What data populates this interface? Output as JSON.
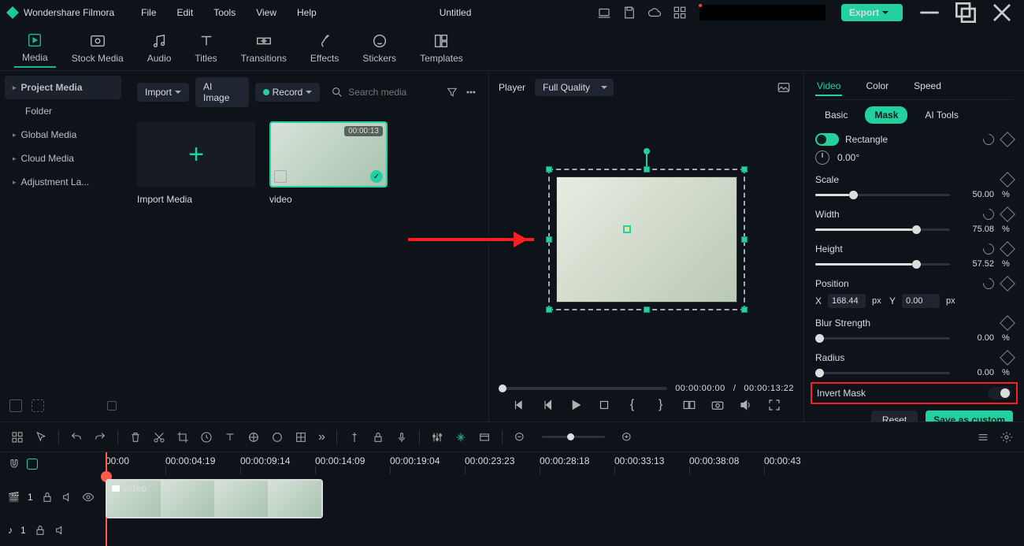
{
  "app_title": "Wondershare Filmora",
  "menus": [
    "File",
    "Edit",
    "Tools",
    "View",
    "Help"
  ],
  "doc_title": "Untitled",
  "export_label": "Export",
  "main_tabs": [
    {
      "label": "Media",
      "active": true
    },
    {
      "label": "Stock Media"
    },
    {
      "label": "Audio"
    },
    {
      "label": "Titles"
    },
    {
      "label": "Transitions"
    },
    {
      "label": "Effects"
    },
    {
      "label": "Stickers"
    },
    {
      "label": "Templates"
    }
  ],
  "sidebar": [
    {
      "label": "Project Media",
      "active": true
    },
    {
      "label": "Folder",
      "indent": true
    },
    {
      "label": "Global Media",
      "expand": true
    },
    {
      "label": "Cloud Media",
      "expand": true
    },
    {
      "label": "Adjustment La...",
      "expand": true
    }
  ],
  "media_toolbar": {
    "import": "Import",
    "ai_image": "AI Image",
    "record": "Record",
    "search_placeholder": "Search media"
  },
  "media_cards": [
    {
      "label": "Import Media",
      "type": "import"
    },
    {
      "label": "video",
      "type": "video",
      "duration": "00:00:13"
    }
  ],
  "player": {
    "label": "Player",
    "quality": "Full Quality",
    "pos": "00:00:00:00",
    "dur": "00:00:13:22"
  },
  "props": {
    "tabs": [
      "Video",
      "Color",
      "Speed"
    ],
    "sub": [
      "Basic",
      "Mask",
      "AI Tools"
    ],
    "shape": "Rectangle",
    "rot_label": "0.00°",
    "scale": {
      "label": "Scale",
      "val": "50.00",
      "unit": "%",
      "pct": 25
    },
    "width": {
      "label": "Width",
      "val": "75.08",
      "unit": "%",
      "pct": 72
    },
    "height": {
      "label": "Height",
      "val": "57.52",
      "unit": "%",
      "pct": 72
    },
    "position": {
      "label": "Position",
      "x_l": "X",
      "x": "168.44",
      "x_u": "px",
      "y_l": "Y",
      "y": "0.00",
      "y_u": "px"
    },
    "blur": {
      "label": "Blur Strength",
      "val": "0.00",
      "unit": "%",
      "pct": 0
    },
    "radius": {
      "label": "Radius",
      "val": "0.00",
      "unit": "%",
      "pct": 0
    },
    "invert": "Invert Mask",
    "reset": "Reset",
    "save": "Save as custom"
  },
  "timeline": {
    "ticks": [
      "00:00",
      "00:00:04:19",
      "00:00:09:14",
      "00:00:14:09",
      "00:00:19:04",
      "00:00:23:23",
      "00:00:28:18",
      "00:00:33:13",
      "00:00:38:08",
      "00:00:43"
    ],
    "track1_icon": "🎬",
    "track1_idx": "1",
    "track2_icon": "♪",
    "track2_idx": "1",
    "clip_label": "video"
  }
}
